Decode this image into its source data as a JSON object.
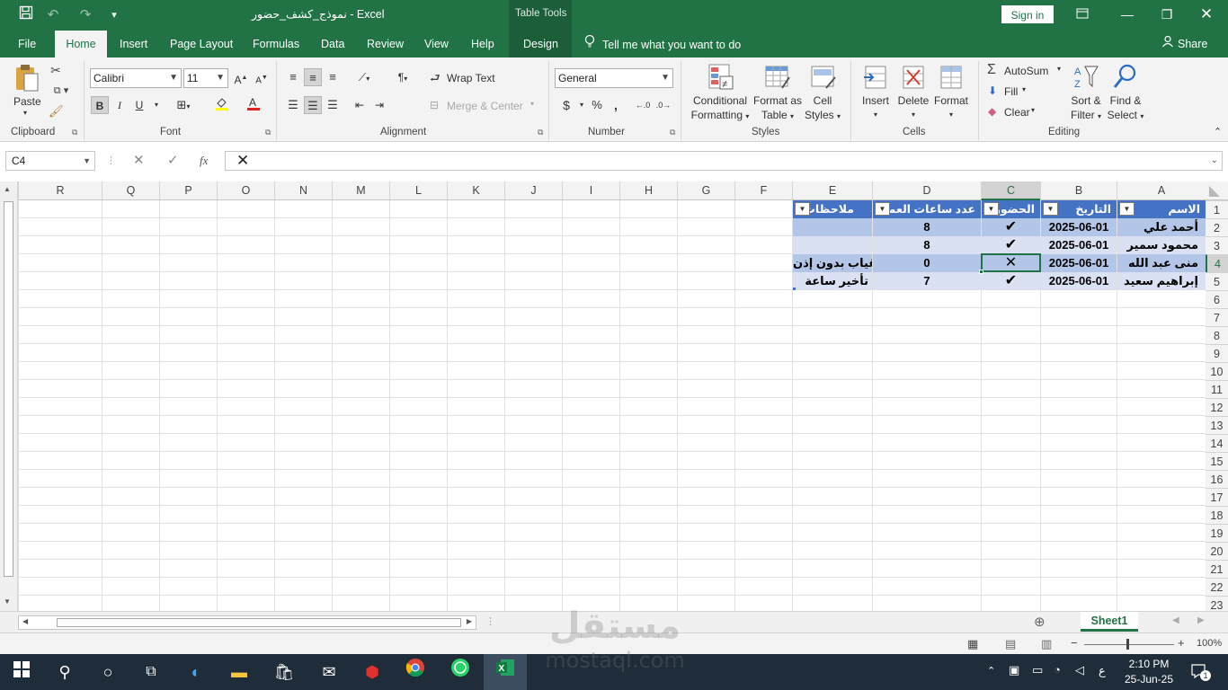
{
  "window": {
    "file_name": "نموذج_كشف_حضور",
    "app_name": "Excel",
    "title_sep": " - ",
    "table_tools": "Table Tools",
    "sign_in": "Sign in"
  },
  "ribbon_tabs": [
    "File",
    "Home",
    "Insert",
    "Page Layout",
    "Formulas",
    "Data",
    "Review",
    "View",
    "Help",
    "Design"
  ],
  "tell_me": "Tell me what you want to do",
  "share": "Share",
  "clipboard": {
    "paste": "Paste",
    "label": "Clipboard"
  },
  "font": {
    "name": "Calibri",
    "size": "11",
    "bold": "B",
    "italic": "I",
    "underline": "U",
    "label": "Font"
  },
  "alignment": {
    "wrap_text": "Wrap Text",
    "merge_center": "Merge & Center",
    "label": "Alignment"
  },
  "number": {
    "format": "General",
    "currency": "$",
    "percent": "%",
    "comma": ",",
    "label": "Number"
  },
  "styles": {
    "conditional_1": "Conditional",
    "conditional_2": "Formatting",
    "format_table_1": "Format as",
    "format_table_2": "Table",
    "cell_styles_1": "Cell",
    "cell_styles_2": "Styles",
    "label": "Styles"
  },
  "cells": {
    "insert": "Insert",
    "delete": "Delete",
    "format": "Format",
    "label": "Cells"
  },
  "editing": {
    "autosum": "AutoSum",
    "fill": "Fill",
    "clear": "Clear",
    "sort_1": "Sort &",
    "sort_2": "Filter",
    "find_1": "Find &",
    "find_2": "Select",
    "label": "Editing"
  },
  "formula_bar": {
    "name_box": "C4",
    "fx": "fx",
    "value": "✕"
  },
  "columns": [
    "A",
    "B",
    "C",
    "D",
    "E",
    "F",
    "G",
    "H",
    "I",
    "J",
    "K",
    "L",
    "M",
    "N",
    "O",
    "P",
    "Q",
    "R"
  ],
  "rows": [
    "1",
    "2",
    "3",
    "4",
    "5",
    "6",
    "7",
    "8",
    "9",
    "10",
    "11",
    "12",
    "13",
    "14",
    "15",
    "16",
    "17",
    "18",
    "19",
    "20",
    "21",
    "22",
    "23"
  ],
  "table": {
    "headers": [
      "الاسم",
      "التاريخ",
      "الحضور",
      "عدد ساعات العمل",
      "ملاحظات"
    ],
    "rows": [
      {
        "name": "أحمد علي",
        "date": "2025-06-01",
        "attendance": "✔",
        "hours": "8",
        "notes": ""
      },
      {
        "name": "محمود سمير",
        "date": "2025-06-01",
        "attendance": "✔",
        "hours": "8",
        "notes": ""
      },
      {
        "name": "منى عبد الله",
        "date": "2025-06-01",
        "attendance": "✕",
        "hours": "0",
        "notes": "غياب بدون إذن"
      },
      {
        "name": "إبراهيم سعيد",
        "date": "2025-06-01",
        "attendance": "✔",
        "hours": "7",
        "notes": "تأخير ساعة"
      }
    ]
  },
  "sheet_tab": "Sheet1",
  "zoom": "100%",
  "taskbar": {
    "time": "2:10 PM",
    "date": "25-Jun-25",
    "lang": "ع",
    "notifications": "1"
  },
  "watermark": {
    "logo": "مستقل",
    "url": "mostaql.com"
  },
  "colors": {
    "excel_green": "#217346",
    "table_header": "#4472c4",
    "band_dark": "#b4c6e7",
    "band_light": "#d9e1f2"
  }
}
